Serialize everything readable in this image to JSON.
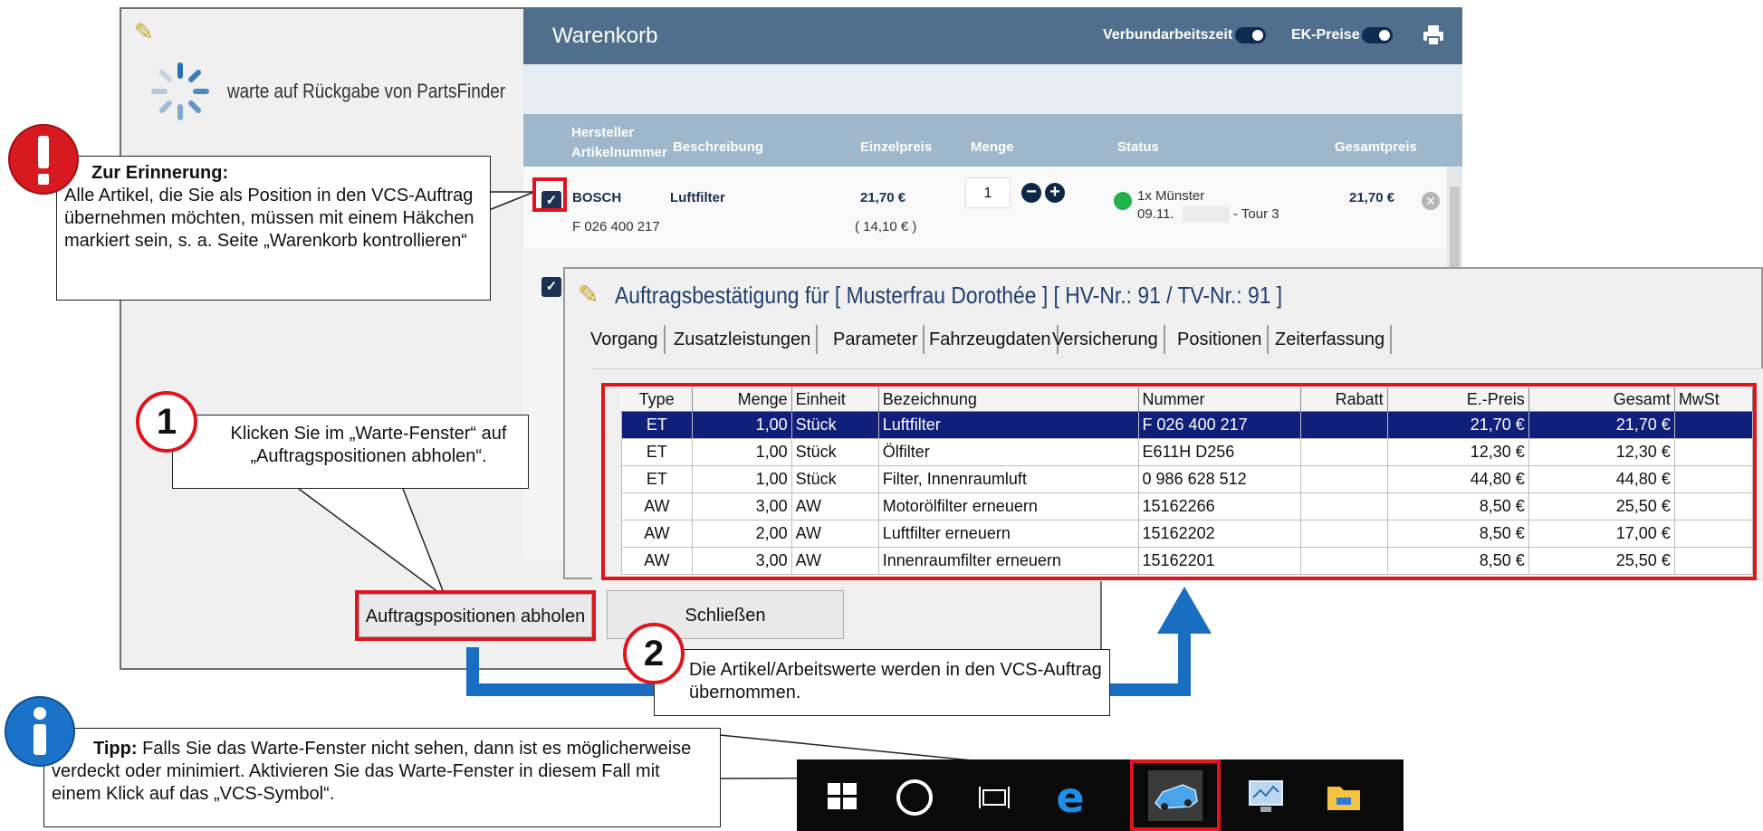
{
  "wait_window": {
    "message": "warte auf Rückgabe von PartsFinder"
  },
  "cart": {
    "title": "Warenkorb",
    "toggles": [
      {
        "label": "Verbundarbeitszeit"
      },
      {
        "label": "EK-Preise"
      }
    ],
    "columns": {
      "hersteller": "Hersteller",
      "artikelnummer": "Artikelnummer",
      "beschreibung": "Beschreibung",
      "einzelpreis": "Einzelpreis",
      "menge": "Menge",
      "status": "Status",
      "gesamtpreis": "Gesamtpreis"
    },
    "row1": {
      "hersteller": "BOSCH",
      "artikelnummer": "F 026 400 217",
      "beschreibung": "Luftfilter",
      "einzelpreis": "21,70 €",
      "ek_preis": "( 14,10 € )",
      "menge": "1",
      "status_line1": "1x Münster",
      "status_date": "09.11.",
      "status_tour": "- Tour 3",
      "gesamtpreis": "21,70 €"
    }
  },
  "order": {
    "title": "Auftragsbestätigung  für [ Musterfrau Dorothée ]  [ HV-Nr.: 91 / TV-Nr.: 91 ]",
    "tabs": [
      "Vorgang",
      "Zusatzleistungen",
      "Parameter",
      "Fahrzeugdaten",
      "Versicherung",
      "Positionen",
      "Zeiterfassung"
    ],
    "table": {
      "headers": [
        "Type",
        "Menge",
        "Einheit",
        "Bezeichnung",
        "Nummer",
        "Rabatt",
        "E.-Preis",
        "Gesamt",
        "MwSt"
      ],
      "rows": [
        [
          "ET",
          "1,00",
          "Stück",
          "Luftfilter",
          "F 026 400 217",
          "",
          "21,70 €",
          "21,70 €",
          ""
        ],
        [
          "ET",
          "1,00",
          "Stück",
          "Ölfilter",
          "E611H D256",
          "",
          "12,30 €",
          "12,30 €",
          ""
        ],
        [
          "ET",
          "1,00",
          "Stück",
          "Filter, Innenraumluft",
          "0 986 628 512",
          "",
          "44,80 €",
          "44,80 €",
          ""
        ],
        [
          "AW",
          "3,00",
          "AW",
          "Motorölfilter erneuern",
          "15162266",
          "",
          "8,50 €",
          "25,50 €",
          ""
        ],
        [
          "AW",
          "2,00",
          "AW",
          "Luftfilter erneuern",
          "15162202",
          "",
          "8,50 €",
          "17,00 €",
          ""
        ],
        [
          "AW",
          "3,00",
          "AW",
          "Innenraumfilter erneuern",
          "15162201",
          "",
          "8,50 €",
          "25,50 €",
          ""
        ]
      ]
    }
  },
  "buttons": {
    "fetch": "Auftragspositionen abholen",
    "close": "Schließen"
  },
  "callouts": {
    "reminder_title": "Zur Erinnerung:",
    "reminder_text": "Alle Artikel, die Sie als Position in den VCS-Auftrag übernehmen möchten, müssen mit einem Häkchen markiert sein, s. a. Seite „Warenkorb kontrollieren“",
    "step1_number": "1",
    "step1_text": "Klicken Sie im „Warte-Fenster“ auf „Auftragspositionen abholen“.",
    "step2_number": "2",
    "step2_text": "Die Artikel/Arbeitswerte werden in den VCS-Auftrag übernommen.",
    "tip_title": "Tipp:",
    "tip_text": "Falls Sie das Warte-Fenster nicht sehen, dann ist es möglicherweise verdeckt oder minimiert. Aktivieren Sie das Warte-Fenster in diesem Fall mit einem Klick auf das „VCS-Symbol“."
  },
  "colors": {
    "highlight_red": "#e0141c",
    "arrow_blue": "#1a6ec2",
    "cart_header": "#4f6f8c",
    "selected_row": "#0f1f7a"
  },
  "taskbar": {
    "icons": [
      "windows-start-icon",
      "cortana-circle-icon",
      "task-view-icon",
      "edge-browser-icon",
      "vcs-car-icon",
      "monitor-app-icon",
      "file-explorer-icon"
    ]
  }
}
